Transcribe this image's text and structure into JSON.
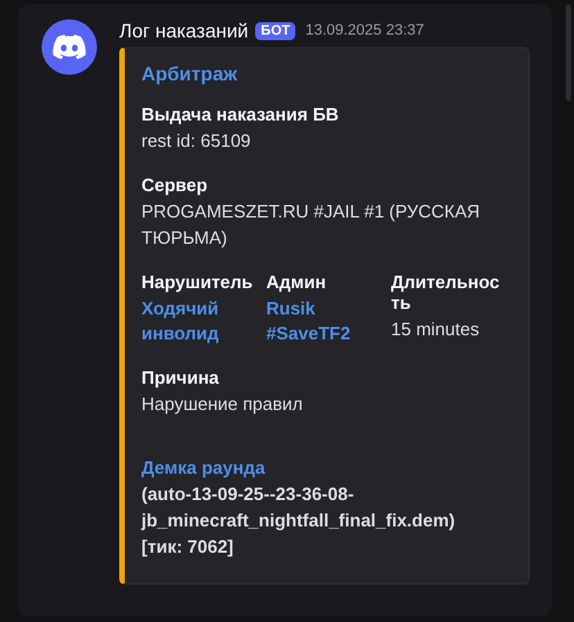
{
  "message": {
    "author": "Лог наказаний",
    "badge": "БОТ",
    "timestamp": "13.09.2025 23:37"
  },
  "embed": {
    "color": "#f0a500",
    "title": "Арбитраж",
    "fields": [
      {
        "kind": "block",
        "name": "Выдача наказания БВ",
        "value": "rest id: 65109"
      },
      {
        "kind": "block",
        "name": "Сервер",
        "value": "PROGAMESZET.RU #JAIL #1 (РУССКАЯ ТЮРЬМА)"
      },
      {
        "kind": "inline",
        "name": "Нарушитель",
        "value": "Ходячий инволид",
        "link": true
      },
      {
        "kind": "inline",
        "name": "Админ",
        "value": "Rusik #SaveTF2",
        "link": true
      },
      {
        "kind": "inline",
        "name": "Длительность",
        "value": "15 minutes",
        "link": false
      },
      {
        "kind": "block",
        "name": "Причина",
        "value": "Нарушение правил"
      },
      {
        "kind": "accent",
        "name": "Демка раунда",
        "value": "(auto-13-09-25--23-36-08-jb_minecraft_nightfall_final_fix.dem)\n[тик: 7062]"
      }
    ]
  }
}
